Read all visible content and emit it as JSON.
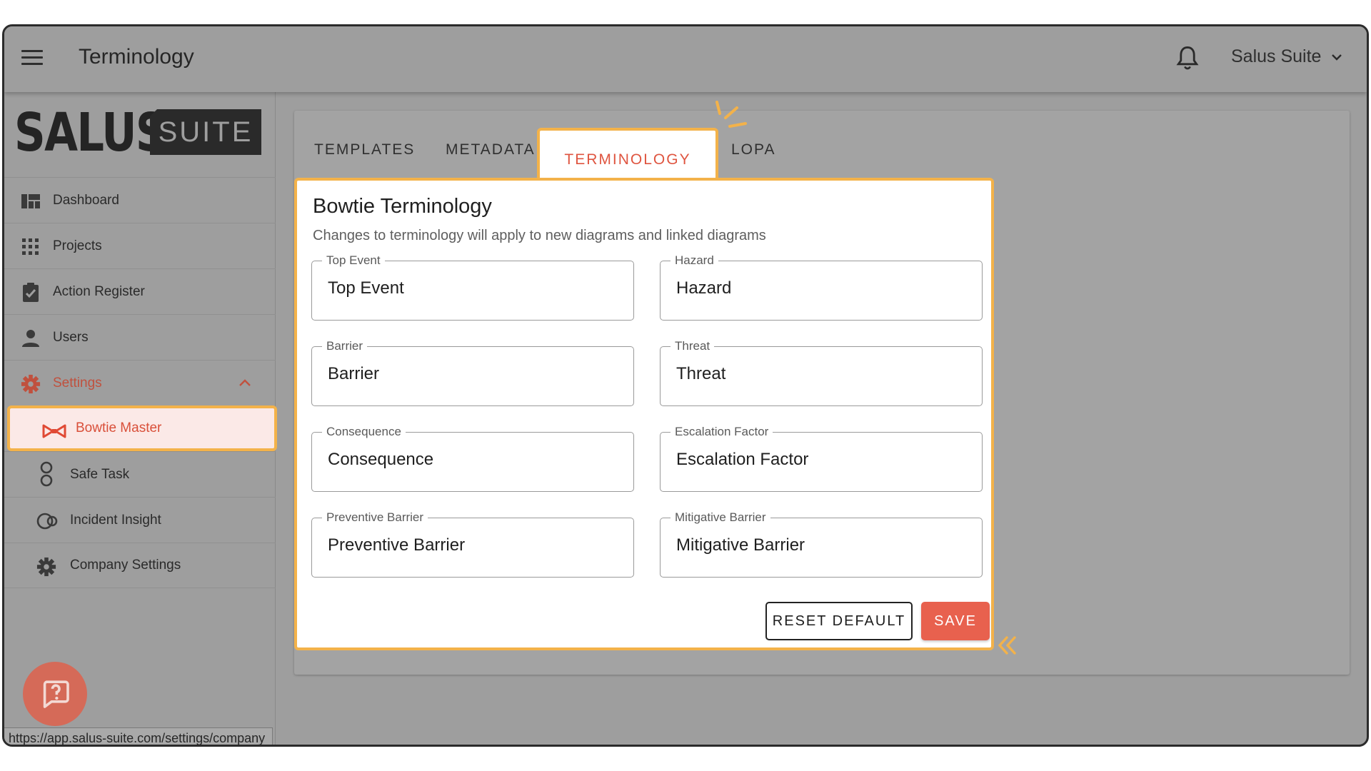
{
  "header": {
    "title": "Terminology",
    "account_name": "Salus Suite"
  },
  "logo": {
    "primary": "SALUS",
    "secondary": "SUITE"
  },
  "sidebar": {
    "items": [
      {
        "label": "Dashboard",
        "icon": "dashboard-icon"
      },
      {
        "label": "Projects",
        "icon": "projects-grid-icon"
      },
      {
        "label": "Action Register",
        "icon": "clipboard-check-icon"
      },
      {
        "label": "Users",
        "icon": "user-icon"
      },
      {
        "label": "Settings",
        "icon": "gear-icon",
        "expanded": true
      },
      {
        "label": "Bowtie Master",
        "icon": "bowtie-icon",
        "active": true
      },
      {
        "label": "Safe Task",
        "icon": "safe-task-icon"
      },
      {
        "label": "Incident Insight",
        "icon": "incident-insight-icon"
      },
      {
        "label": "Company Settings",
        "icon": "gear-icon"
      }
    ]
  },
  "tabs": [
    {
      "label": "TEMPLATES"
    },
    {
      "label": "METADATA"
    },
    {
      "label": "TERMINOLOGY",
      "active": true
    },
    {
      "label": "LOPA"
    }
  ],
  "card": {
    "title": "Bowtie Terminology",
    "subtitle": "Changes to terminology will apply to new diagrams and linked diagrams",
    "fields": [
      {
        "label": "Top Event",
        "value": "Top Event"
      },
      {
        "label": "Hazard",
        "value": "Hazard"
      },
      {
        "label": "Barrier",
        "value": "Barrier"
      },
      {
        "label": "Threat",
        "value": "Threat"
      },
      {
        "label": "Consequence",
        "value": "Consequence"
      },
      {
        "label": "Escalation Factor",
        "value": "Escalation Factor"
      },
      {
        "label": "Preventive Barrier",
        "value": "Preventive Barrier"
      },
      {
        "label": "Mitigative Barrier",
        "value": "Mitigative Barrier"
      }
    ],
    "reset_label": "RESET DEFAULT",
    "save_label": "SAVE"
  },
  "status_bar": {
    "url": "https://app.salus-suite.com/settings/company"
  },
  "colors": {
    "accent": "#e8614e",
    "highlight": "#f3b24a",
    "overlay": "#9e9e9e"
  }
}
